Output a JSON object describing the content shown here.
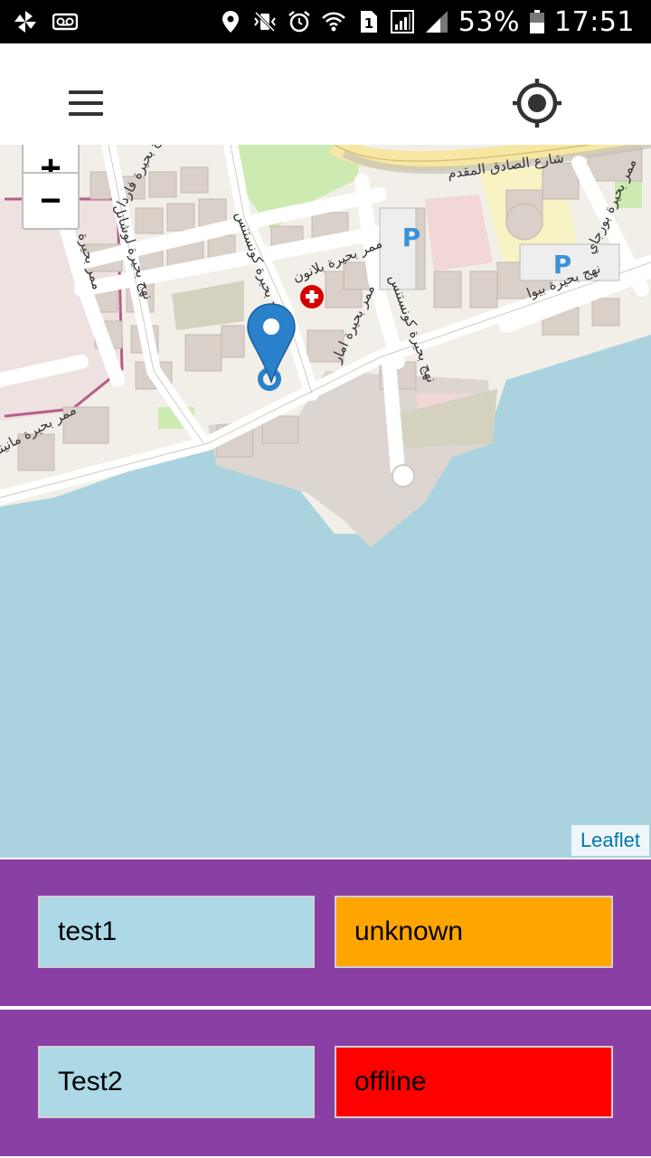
{
  "status_bar": {
    "battery_percent": "53%",
    "time": "17:51",
    "sim_label": "1"
  },
  "app_bar": {
    "menu_icon": "hamburger-menu-icon",
    "locate_icon": "crosshair-locate-icon"
  },
  "map": {
    "zoom_in_label": "+",
    "zoom_out_label": "−",
    "attribution": "Leaflet",
    "street_labels": [
      "شارع الصادق المقدم",
      "ممر بحيرة بلانون",
      "ممر بحيرة امار",
      "نهج بحيرة كونستنس",
      "نهج بحيرة كونستنس",
      "نهج بحيرة فاردا",
      "نهج بحيرة لوشانل",
      "ممر بحيرة مانيتو",
      "ممر بحيرة",
      "نهج بحيرة بيوا",
      "ممر بحيرة بورجاي"
    ],
    "colors": {
      "water": "#aad3df",
      "land": "#f2efe9",
      "road": "#ffffff",
      "building": "#d9d0c9",
      "park": "#cdebb0",
      "marker": "#2a81cb"
    }
  },
  "devices": [
    {
      "name": "test1",
      "status": "unknown",
      "status_color": "#ffa500"
    },
    {
      "name": "Test2",
      "status": "offline",
      "status_color": "#ff0000"
    }
  ],
  "colors": {
    "device_row_bg": "#8a3fa4",
    "name_box_bg": "#add8e6"
  }
}
